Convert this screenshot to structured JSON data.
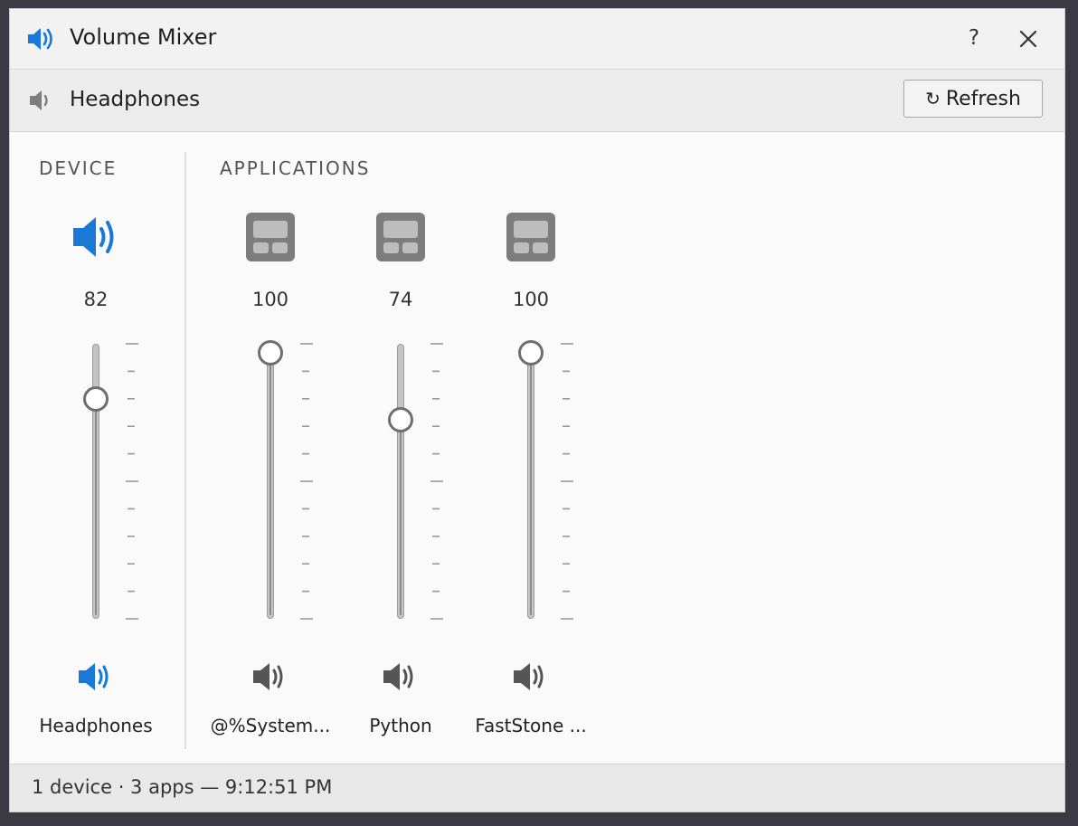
{
  "window": {
    "title": "Volume Mixer",
    "help_label": "?",
    "accent_color": "#1a78d6",
    "icon_gray": "#7d7d7d"
  },
  "subbar": {
    "device_name": "Headphones",
    "refresh_label": "Refresh"
  },
  "sections": {
    "device_label": "DEVICE",
    "applications_label": "APPLICATIONS"
  },
  "device": {
    "name": "Headphones",
    "volume": 82,
    "icon": "speaker-icon"
  },
  "applications": [
    {
      "name": "@%System...",
      "volume": 100,
      "icon": "app-window-icon"
    },
    {
      "name": "Python",
      "volume": 74,
      "icon": "app-window-icon"
    },
    {
      "name": "FastStone ...",
      "volume": 100,
      "icon": "app-window-icon"
    }
  ],
  "status": {
    "text": "1 device · 3 apps — 9:12:51 PM"
  }
}
